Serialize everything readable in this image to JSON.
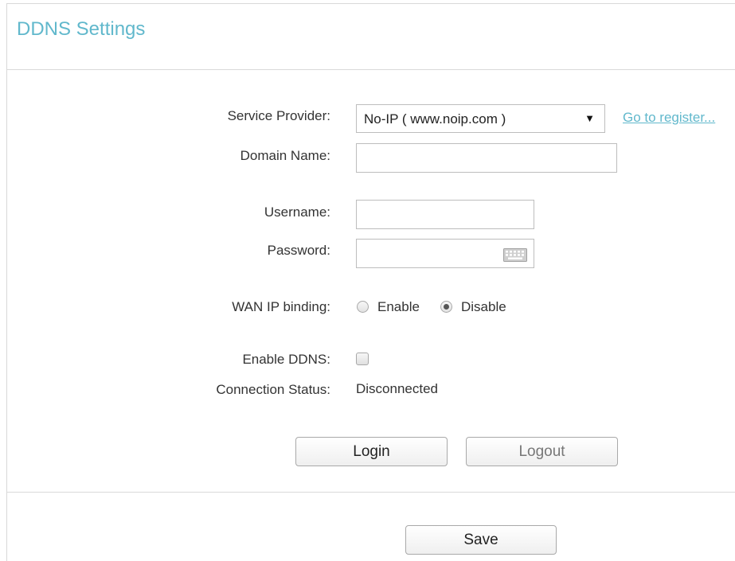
{
  "header": {
    "title": "DDNS Settings"
  },
  "form": {
    "service_provider": {
      "label": "Service Provider:",
      "value": "No-IP ( www.noip.com )",
      "register_link": "Go to register..."
    },
    "domain_name": {
      "label": "Domain Name:",
      "value": ""
    },
    "username": {
      "label": "Username:",
      "value": ""
    },
    "password": {
      "label": "Password:",
      "value": ""
    },
    "wan_ip_binding": {
      "label": "WAN IP binding:",
      "options": [
        "Enable",
        "Disable"
      ],
      "selected": "Disable"
    },
    "enable_ddns": {
      "label": "Enable DDNS:",
      "checked": false
    },
    "connection_status": {
      "label": "Connection Status:",
      "value": "Disconnected"
    }
  },
  "buttons": {
    "login": "Login",
    "logout": "Logout",
    "save": "Save"
  },
  "icons": {
    "keyboard": "keyboard-icon",
    "dropdown": "dropdown-arrow-icon"
  },
  "colors": {
    "accent": "#61b8cc",
    "border": "#bdbdbd",
    "text": "#333333"
  }
}
